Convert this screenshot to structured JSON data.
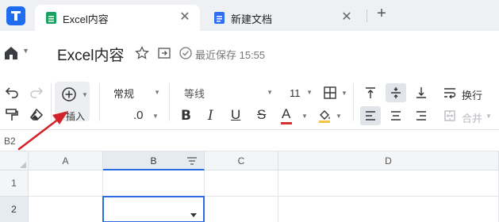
{
  "tabs": [
    {
      "title": "Excel内容",
      "active": true,
      "icon": "sheet-icon",
      "icon_color": "#1aa260"
    },
    {
      "title": "新建文档",
      "active": false,
      "icon": "doc-icon",
      "icon_color": "#2f6ff0"
    }
  ],
  "tab_close_glyph": "✕",
  "new_tab_glyph": "+",
  "doc": {
    "title": "Excel内容",
    "save_status": "最近保存 15:55"
  },
  "toolbar": {
    "insert_label": "插入",
    "number_format": "常规",
    "decimal_label": ".0",
    "font_name": "等线",
    "font_size": "11",
    "bold": "B",
    "italic": "I",
    "underline": "U",
    "strike": "S",
    "font_color_glyph": "A",
    "font_color": "#d62f2f",
    "wrap_label": "换行",
    "merge_label": "合并"
  },
  "formula_bar": {
    "cell_ref": "B2"
  },
  "grid": {
    "columns": [
      "A",
      "B",
      "C",
      "D"
    ],
    "rows": [
      "1",
      "2"
    ],
    "selected_column": "B",
    "selected_row": "2"
  },
  "colors": {
    "accent": "#2a6de0",
    "annotation_arrow": "#d2232a"
  }
}
